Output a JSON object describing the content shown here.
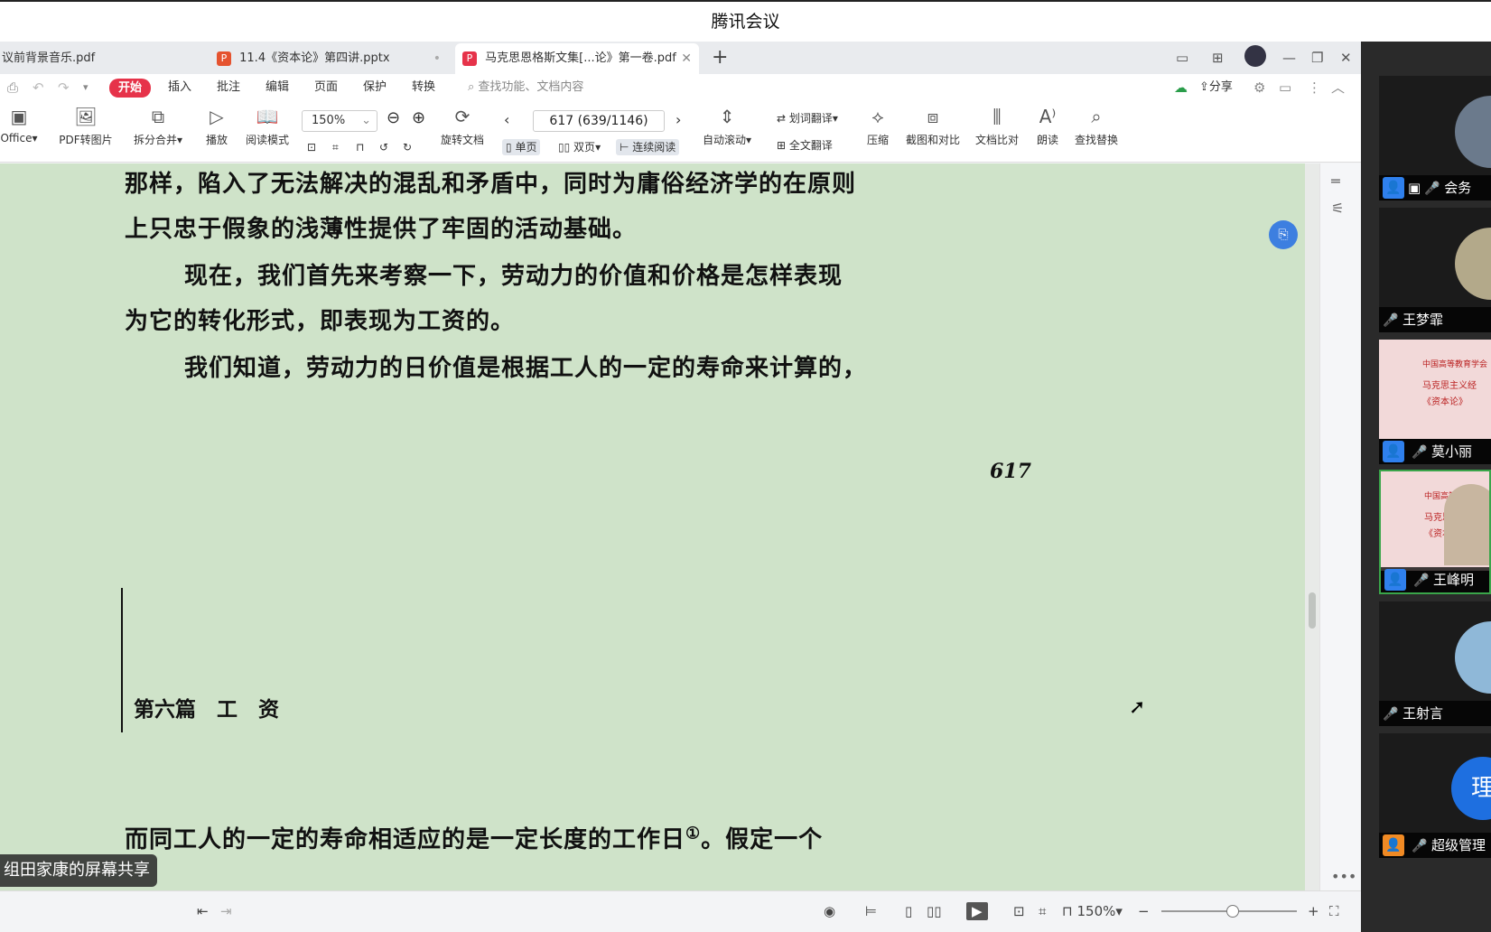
{
  "window": {
    "title": "腾讯会议"
  },
  "tabs": [
    {
      "label": "议前背景音乐.pdf",
      "type": "pdf"
    },
    {
      "label": "11.4《资本论》第四讲.pptx",
      "type": "pptx"
    },
    {
      "label": "马克思恩格斯文集[...论》第一卷.pdf",
      "type": "pdf",
      "active": true
    }
  ],
  "menu": {
    "start": "开始",
    "items": [
      "插入",
      "批注",
      "编辑",
      "页面",
      "保护",
      "转换"
    ],
    "search_placeholder": "查找功能、文档内容",
    "share": "分享"
  },
  "ribbon": {
    "office": "Office",
    "pdf_to_image": "PDF转图片",
    "split_merge": "拆分合并",
    "play": "播放",
    "read_mode": "阅读模式",
    "zoom": "150%",
    "page": "617 (639/1146)",
    "rotate": "旋转文档",
    "single": "单页",
    "double": "双页",
    "continuous": "连续阅读",
    "auto_scroll": "自动滚动",
    "word_translate": "划词翻译",
    "full_translate": "全文翻译",
    "compress": "压缩",
    "screenshot_compare": "截图和对比",
    "doc_compare": "文档比对",
    "read_aloud": "朗读",
    "find_replace": "查找替换"
  },
  "document": {
    "lines": [
      "那样，陷入了无法解决的混乱和矛盾中，同时为庸俗经济学的在原则",
      "上只忠于假象的浅薄性提供了牢固的活动基础。",
      "现在，我们首先来考察一下，劳动力的价值和价格是怎样表现",
      "为它的转化形式，即表现为工资的。",
      "我们知道，劳动力的日价值是根据工人的一定的寿命来计算的，"
    ],
    "page_number": "617",
    "section_heading": "第六篇　工　资",
    "bottom_line": "而同工人的一定的寿命相适应的是一定长度的工作日",
    "footnote_mark": "①",
    "bottom_line_rest": "。假定一个"
  },
  "status": {
    "zoom": "150%",
    "share_label": "组田家康的屏幕共享"
  },
  "participants": [
    {
      "name": "会务",
      "mic": "muted"
    },
    {
      "name": "王梦霏",
      "mic": "muted"
    },
    {
      "name": "莫小丽",
      "mic": "muted",
      "slide": true
    },
    {
      "name": "王峰明",
      "mic": "on",
      "slide": true,
      "active": true
    },
    {
      "name": "王射言",
      "mic": "muted"
    },
    {
      "name": "超级管理",
      "mic": "muted",
      "initial": "理"
    }
  ],
  "slide_text": {
    "line1": "中国高等教育学会",
    "line2": "马克思主义经",
    "line3": "《资本论》"
  }
}
